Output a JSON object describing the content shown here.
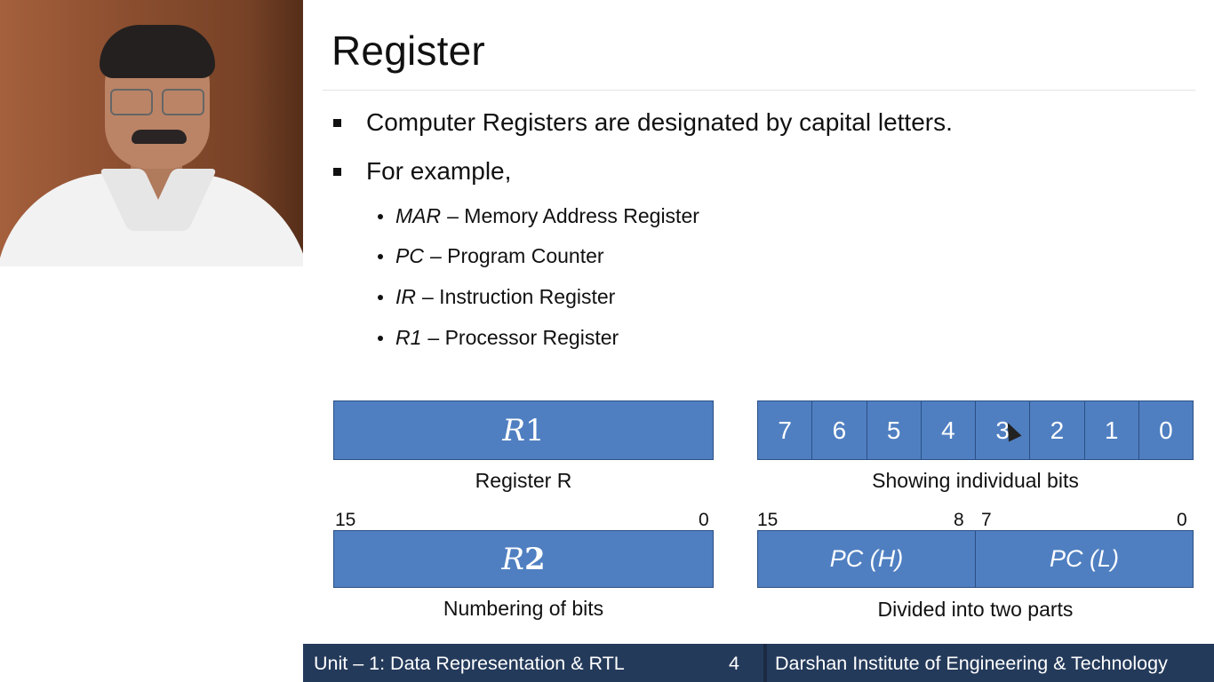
{
  "slide": {
    "title": "Register",
    "bullets": [
      "Computer Registers are designated by capital letters.",
      "For example,"
    ],
    "examples": [
      {
        "abbr": "MAR",
        "desc": "– Memory Address Register"
      },
      {
        "abbr": "PC",
        "desc": "– Program Counter"
      },
      {
        "abbr": "IR",
        "desc": "– Instruction Register"
      },
      {
        "abbr": "R1",
        "desc": "– Processor Register"
      }
    ],
    "diagrams": {
      "register_r1": {
        "label_prefix": "R",
        "label_digit": "1",
        "caption": "Register R"
      },
      "individual_bits": {
        "bits": [
          "7",
          "6",
          "5",
          "4",
          "3",
          "2",
          "1",
          "0"
        ],
        "caption": "Showing individual bits"
      },
      "numbering": {
        "label_prefix": "R",
        "label_digit": "2",
        "high": "15",
        "low": "0",
        "caption": "Numbering of bits"
      },
      "two_parts": {
        "high": "15",
        "mid_high": "8",
        "mid_low": "7",
        "low": "0",
        "left_part": "PC (H)",
        "right_part": "PC (L)",
        "caption": "Divided into two parts"
      }
    }
  },
  "footer": {
    "unit": "Unit – 1: Data Representation & RTL",
    "page": "4",
    "institute": "Darshan Institute of Engineering & Technology"
  },
  "colors": {
    "box_fill": "#4f7fc1",
    "box_border": "#2b4f85",
    "footer_bg": "#243a5a"
  }
}
